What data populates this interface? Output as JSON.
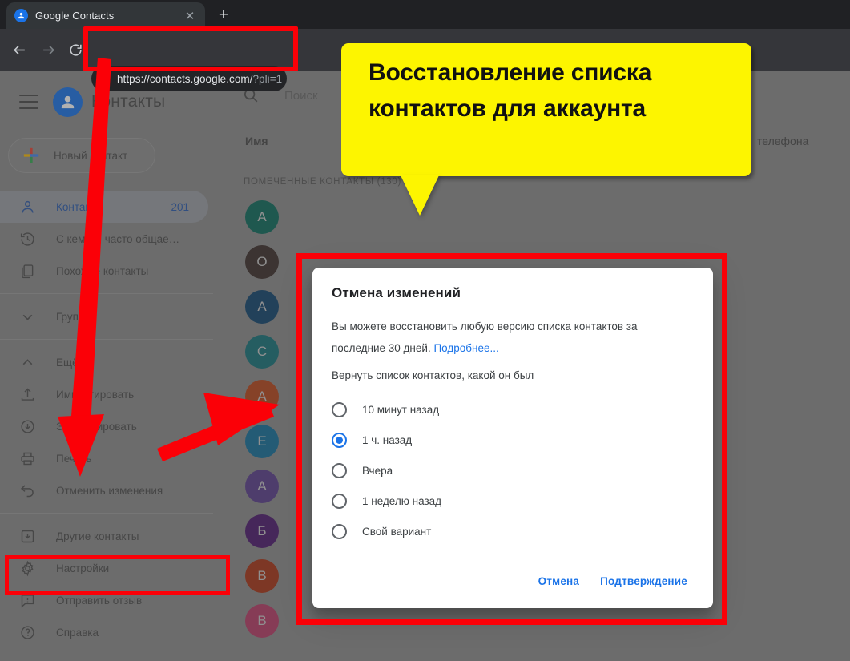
{
  "browser": {
    "tab": {
      "title": "Google Contacts",
      "favicon_icon": "person-avatar-icon",
      "close_icon": "close-icon"
    },
    "new_tab_label": "+",
    "back_icon": "arrow-back-icon",
    "forward_icon": "arrow-forward-icon",
    "reload_icon": "reload-icon",
    "lock_icon": "lock-icon",
    "url_main": "https://contacts.google.com/",
    "url_query": "?pli=1"
  },
  "sidebar": {
    "menu_icon": "hamburger-menu-icon",
    "logo_icon": "google-contacts-logo-icon",
    "app_title": "Контакты",
    "new_contact": {
      "label": "Новый контакт",
      "icon": "plus-icon"
    },
    "items": [
      {
        "label": "Контакты",
        "icon": "person-icon",
        "count": "201",
        "active": true
      },
      {
        "label": "С кем вы часто общае…",
        "icon": "history-icon",
        "count": "",
        "active": false
      },
      {
        "label": "Похожие контакты",
        "icon": "duplicate-icon",
        "count": "",
        "active": false
      }
    ],
    "groups": {
      "label": "Группы",
      "icon": "chevron-down-icon"
    },
    "more": {
      "label": "Ещё",
      "icon": "chevron-up-icon"
    },
    "more_items": [
      {
        "label": "Импортировать",
        "icon": "import-icon"
      },
      {
        "label": "Экспортировать",
        "icon": "export-icon"
      },
      {
        "label": "Печать",
        "icon": "print-icon"
      },
      {
        "label": "Отменить изменения",
        "icon": "undo-icon"
      }
    ],
    "footer_items": [
      {
        "label": "Другие контакты",
        "icon": "other-contacts-icon"
      },
      {
        "label": "Настройки",
        "icon": "gear-icon"
      },
      {
        "label": "Отправить отзыв",
        "icon": "feedback-icon"
      },
      {
        "label": "Справка",
        "icon": "help-icon"
      }
    ]
  },
  "main": {
    "search": {
      "placeholder": "Поиск",
      "icon": "search-icon"
    },
    "column_name": "Имя",
    "column_phone": "телефона",
    "section_label": "ПОМЕЧЕННЫЕ КОНТАКТЫ (130)",
    "contacts": [
      {
        "initial": "А",
        "color": "#0d6b5c"
      },
      {
        "initial": "О",
        "color": "#3d302c"
      },
      {
        "initial": "А",
        "color": "#12456e"
      },
      {
        "initial": "С",
        "color": "#16737b"
      },
      {
        "initial": "А",
        "color": "#b8461c"
      },
      {
        "initial": "Е",
        "color": "#15719c"
      },
      {
        "initial": "А",
        "color": "#5b3f8c"
      },
      {
        "initial": "Б",
        "color": "#4d1a6e"
      },
      {
        "initial": "В",
        "color": "#a93417"
      },
      {
        "initial": "В",
        "color": "#b83d68"
      }
    ]
  },
  "dialog": {
    "title": "Отмена изменений",
    "body_before_link": "Вы можете восстановить любую версию списка контактов за последние 30 дней. ",
    "body_link": "Подробнее...",
    "subtitle": "Вернуть список контактов, какой он был",
    "options": [
      {
        "label": "10 минут назад",
        "selected": false
      },
      {
        "label": "1 ч. назад",
        "selected": true
      },
      {
        "label": "Вчера",
        "selected": false
      },
      {
        "label": "1 неделю назад",
        "selected": false
      },
      {
        "label": "Свой вариант",
        "selected": false
      }
    ],
    "cancel_label": "Отмена",
    "confirm_label": "Подтверждение"
  },
  "annotations": {
    "callout_text": "Восстановление списка контактов для аккаунта",
    "callout_color": "#fdf500",
    "highlight_color": "#fb0007",
    "arrow_color": "#fb0007",
    "arrow_url_to_print": "arrow-icon",
    "arrow_to_avatar": "arrow-icon"
  }
}
